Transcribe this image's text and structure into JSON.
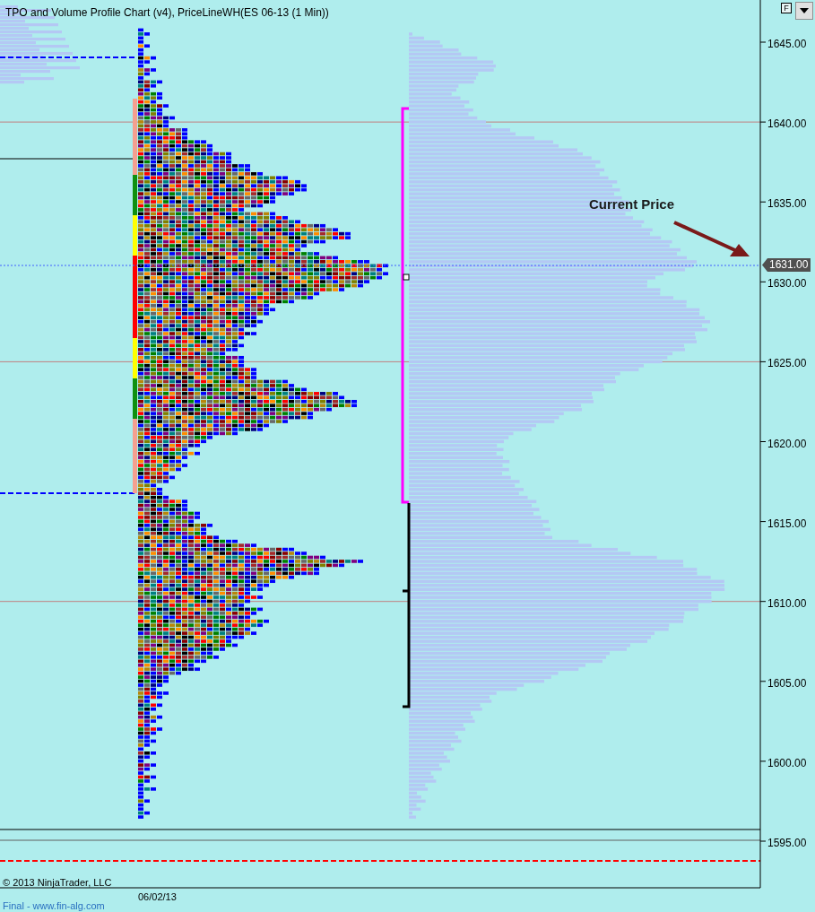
{
  "title": "TPO and Volume Profile Chart (v4), PriceLineWH(ES 06-13 (1 Min))",
  "toolbar": {
    "f_button": "F"
  },
  "price_axis": {
    "labels": [
      "1645.00",
      "1640.00",
      "1635.00",
      "1630.00",
      "1625.00",
      "1620.00",
      "1615.00",
      "1610.00",
      "1605.00",
      "1600.00",
      "1595.00"
    ]
  },
  "current_price": {
    "tag": "1631.00",
    "annotation": "Current Price"
  },
  "copyright": "© 2013 NinjaTrader, LLC",
  "time_axis": {
    "labels": [
      "06/02/13"
    ]
  },
  "footer": "Final - www.fin-alg.com"
}
